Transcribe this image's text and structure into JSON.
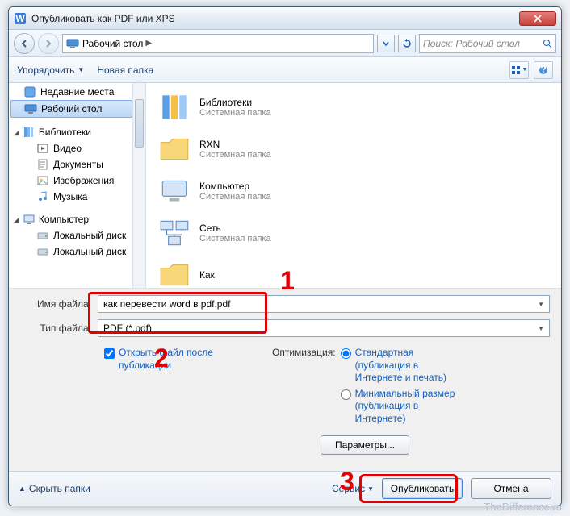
{
  "window": {
    "title": "Опубликовать как PDF или XPS"
  },
  "address": {
    "crumb1": "Рабочий стол",
    "search_placeholder": "Поиск: Рабочий стол"
  },
  "toolbar": {
    "organize": "Упорядочить",
    "new_folder": "Новая папка"
  },
  "sidebar": {
    "recent": "Недавние места",
    "desktop": "Рабочий стол",
    "group_lib": "Библиотеки",
    "video": "Видео",
    "docs": "Документы",
    "images": "Изображения",
    "music": "Музыка",
    "group_comp": "Компьютер",
    "disk1": "Локальный диск",
    "disk2": "Локальный диск"
  },
  "content": {
    "items": [
      {
        "name": "Библиотеки",
        "sub": "Системная папка"
      },
      {
        "name": "RXN",
        "sub": "Системная папка"
      },
      {
        "name": "Компьютер",
        "sub": "Системная папка"
      },
      {
        "name": "Сеть",
        "sub": "Системная папка"
      },
      {
        "name": "Как",
        "sub": ""
      }
    ]
  },
  "form": {
    "filename_label": "Имя файла:",
    "filename_value": "как перевести word в pdf.pdf",
    "filetype_label": "Тип файла:",
    "filetype_value": "PDF (*.pdf)"
  },
  "options": {
    "open_after": "Открыть файл после публикации",
    "optimization_label": "Оптимизация:",
    "opt_standard": "Стандартная (публикация в Интернете и печать)",
    "opt_min": "Минимальный размер (публикация в Интернете)",
    "params_btn": "Параметры..."
  },
  "footer": {
    "hide": "Скрыть папки",
    "tools": "Сервис",
    "publish": "Опубликовать",
    "cancel": "Отмена"
  },
  "annotations": {
    "n1": "1",
    "n2": "2",
    "n3": "3"
  },
  "watermark": "TheDifference.ru"
}
